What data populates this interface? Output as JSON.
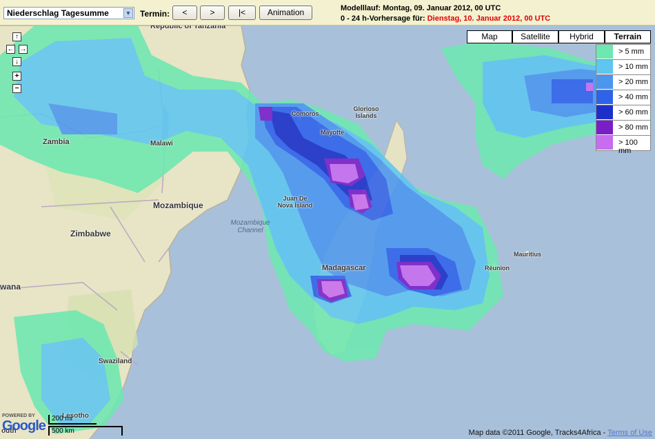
{
  "toolbar": {
    "select_value": "Niederschlag Tagesumme",
    "termin_label": "Termin:",
    "prev_label": "<",
    "next_label": ">",
    "first_label": "|<",
    "animation_label": "Animation",
    "modelllauf": "Modelllauf: Montag, 09. Januar 2012, 00 UTC",
    "forecast_prefix": "0 - 24 h-Vorhersage für: ",
    "forecast_date": "Dienstag, 10. Januar 2012, 00 UTC"
  },
  "map_types": [
    "Map",
    "Satellite",
    "Hybrid",
    "Terrain"
  ],
  "active_map_type": "Terrain",
  "legend": [
    {
      "label": "> 5 mm",
      "color": "#6ee8b0"
    },
    {
      "label": "> 10 mm",
      "color": "#5fc6f0"
    },
    {
      "label": "> 20 mm",
      "color": "#4c96f0"
    },
    {
      "label": "> 40 mm",
      "color": "#2f62ea"
    },
    {
      "label": "> 60 mm",
      "color": "#1d2fc8"
    },
    {
      "label": "> 80 mm",
      "color": "#7a1ec8"
    },
    {
      "label": "> 100 mm",
      "color": "#c86cf0"
    }
  ],
  "places": {
    "tanzania": "Republic of Tanzania",
    "zambia": "Zambia",
    "malawi": "Malawi",
    "mozambique": "Mozambique",
    "zimbabwe": "Zimbabwe",
    "botswana": "wana",
    "swaziland": "Swaziland",
    "lesotho": "Lesotho",
    "comoros": "Comoros",
    "mayotte": "Mayotte",
    "glorioso": "Glorioso Islands",
    "juan_de_nova": "Juan De Nova Island",
    "madagascar": "Madagascar",
    "mauritius": "Mauritius",
    "reunion": "Réunion",
    "mozambique_channel": "Mozambique Channel",
    "south": "outh"
  },
  "scale": {
    "miles": "200 mi",
    "km": "500 km"
  },
  "google": {
    "powered": "POWERED BY",
    "logo": "Google"
  },
  "copyright": {
    "text": "Map data ©2011 Google, Tracks4Africa - ",
    "link": "Terms of Use"
  }
}
